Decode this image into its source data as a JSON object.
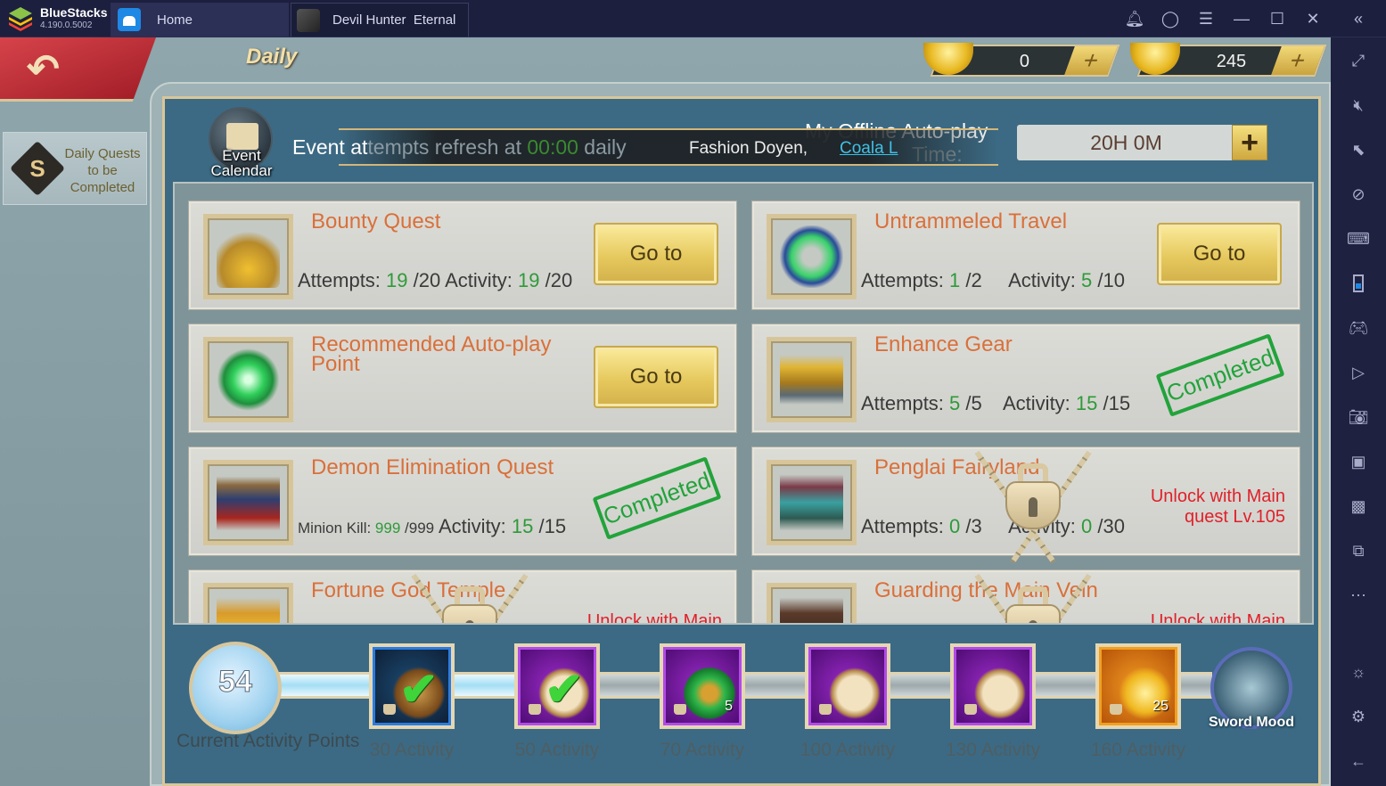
{
  "titlebar": {
    "app_name": "BlueStacks",
    "app_version": "4.190.0.5002",
    "tabs": [
      {
        "label": "Home",
        "icon": "home-icon"
      },
      {
        "label": "Devil Hunter  Eternal",
        "icon": "game-thumbnail-icon"
      }
    ],
    "controls": [
      "bell-icon",
      "account-icon",
      "menu-icon",
      "minimize-icon",
      "maximize-icon",
      "close-icon",
      "collapse-sidebar-icon"
    ]
  },
  "right_sidebar": {
    "icons": [
      "fullscreen-icon",
      "mute-icon",
      "pointer-lock-icon",
      "eye-off-icon",
      "keyboard-icon",
      "portrait-icon",
      "gamepad-icon",
      "macro-icon",
      "camera-icon",
      "record-icon",
      "media-folder-icon",
      "multi-instance-icon",
      "more-icon",
      "brightness-icon",
      "settings-icon",
      "back-arrow-icon"
    ]
  },
  "game": {
    "page_title": "Daily",
    "left_tab": {
      "label": "Daily Quests to be Completed"
    },
    "currencies": [
      {
        "name": "gold-ingot",
        "value": "0"
      },
      {
        "name": "bound-gold-ingot",
        "value": "245"
      }
    ],
    "event_calendar_label": "Event Calendar",
    "refresh": {
      "prefix": "Event at",
      "fade": "tempts refresh at ",
      "time": "00:00",
      "suffix": " daily"
    },
    "banner": {
      "text": "Fashion Doyen,",
      "link": "Coala L"
    },
    "offline": {
      "label": "My Offline Auto-play",
      "sub": "Time:",
      "value": "20H 0M",
      "plus": "+"
    },
    "quests": [
      {
        "name": "Bounty Quest",
        "stat1_label": "Attempts: ",
        "stat1_value": "19",
        "stat1_max": " /20",
        "stat2_label": " Activity: ",
        "stat2_value": "19",
        "stat2_max": " /20",
        "status": "goto",
        "button": "Go to"
      },
      {
        "name": "Untrammeled Travel",
        "stat1_label": "Attempts: ",
        "stat1_value": "1",
        "stat1_max": " /2",
        "stat2_label": "     Activity: ",
        "stat2_value": "5",
        "stat2_max": " /10",
        "status": "goto",
        "button": "Go to"
      },
      {
        "name": "Recommended Auto-play Point",
        "status": "goto",
        "button": "Go to"
      },
      {
        "name": "Enhance Gear",
        "stat1_label": "Attempts: ",
        "stat1_value": "5",
        "stat1_max": " /5",
        "stat2_label": "    Activity: ",
        "stat2_value": "15",
        "stat2_max": " /15",
        "status": "completed",
        "stamp": "Completed"
      },
      {
        "name": "Demon Elimination Quest",
        "stat1_label": "Minion Kill: ",
        "stat1_value": "999",
        "stat1_max": " /999",
        "stat2_label": " Activity: ",
        "stat2_value": "15",
        "stat2_max": " /15",
        "status": "completed",
        "stamp": "Completed"
      },
      {
        "name": "Penglai Fairyland",
        "stat1_label": "Attempts: ",
        "stat1_value": "0",
        "stat1_max": " /3",
        "stat2_label": "     Activity: ",
        "stat2_value": "0",
        "stat2_max": " /30",
        "status": "locked",
        "lock_note": "Unlock with Main quest Lv.105"
      },
      {
        "name": "Fortune God Temple",
        "status": "locked",
        "lock_note": "Unlock with Main"
      },
      {
        "name": "Guarding the Main Vein",
        "status": "locked",
        "lock_note": "Unlock with Main"
      }
    ],
    "activity": {
      "current_points": "54",
      "current_label": "Current Activity Points",
      "progress_fraction": 0.34,
      "rewards": [
        {
          "label": "30 Activity",
          "frame": "blue",
          "item": "scroll-torch",
          "claimed": true,
          "qty": ""
        },
        {
          "label": "50 Activity",
          "frame": "purple",
          "item": "pocket-watch",
          "claimed": true,
          "qty": ""
        },
        {
          "label": "70 Activity",
          "frame": "purple",
          "item": "green-horse-gem",
          "claimed": false,
          "qty": "5"
        },
        {
          "label": "100 Activity",
          "frame": "purple",
          "item": "pocket-watch",
          "claimed": false,
          "qty": ""
        },
        {
          "label": "130 Activity",
          "frame": "purple",
          "item": "pocket-watch",
          "claimed": false,
          "qty": ""
        },
        {
          "label": "160 Activity",
          "frame": "orange",
          "item": "gold-ingot",
          "claimed": false,
          "qty": "25"
        }
      ],
      "sword_mood_label": "Sword Mood"
    }
  }
}
